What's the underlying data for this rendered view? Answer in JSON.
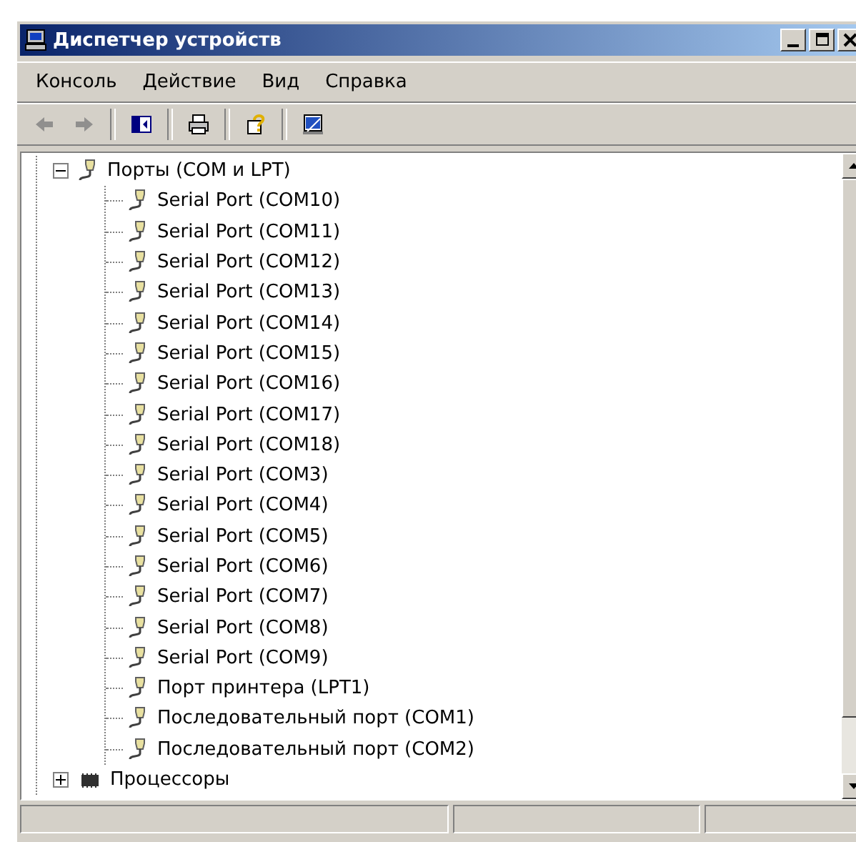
{
  "window": {
    "title": "Диспетчер устройств"
  },
  "menu": [
    "Консоль",
    "Действие",
    "Вид",
    "Справка"
  ],
  "toolbar": [
    {
      "kind": "back",
      "disabled": true
    },
    {
      "kind": "forward",
      "disabled": true
    },
    {
      "kind": "tree-toggle",
      "disabled": false
    },
    {
      "kind": "print",
      "disabled": false
    },
    {
      "kind": "help",
      "disabled": false
    },
    {
      "kind": "update",
      "disabled": false
    }
  ],
  "tree": [
    {
      "label": "Порты (COM и LPT)",
      "kind": "port",
      "expanded": true,
      "children": [
        {
          "label": "Serial Port (COM10)",
          "kind": "port"
        },
        {
          "label": "Serial Port (COM11)",
          "kind": "port"
        },
        {
          "label": "Serial Port (COM12)",
          "kind": "port"
        },
        {
          "label": "Serial Port (COM13)",
          "kind": "port"
        },
        {
          "label": "Serial Port (COM14)",
          "kind": "port"
        },
        {
          "label": "Serial Port (COM15)",
          "kind": "port"
        },
        {
          "label": "Serial Port (COM16)",
          "kind": "port"
        },
        {
          "label": "Serial Port (COM17)",
          "kind": "port"
        },
        {
          "label": "Serial Port (COM18)",
          "kind": "port"
        },
        {
          "label": "Serial Port (COM3)",
          "kind": "port"
        },
        {
          "label": "Serial Port (COM4)",
          "kind": "port"
        },
        {
          "label": "Serial Port (COM5)",
          "kind": "port"
        },
        {
          "label": "Serial Port (COM6)",
          "kind": "port"
        },
        {
          "label": "Serial Port (COM7)",
          "kind": "port"
        },
        {
          "label": "Serial Port (COM8)",
          "kind": "port"
        },
        {
          "label": "Serial Port (COM9)",
          "kind": "port"
        },
        {
          "label": "Порт принтера (LPT1)",
          "kind": "port"
        },
        {
          "label": "Последовательный порт (COM1)",
          "kind": "port"
        },
        {
          "label": "Последовательный порт (COM2)",
          "kind": "port"
        }
      ]
    },
    {
      "label": "Процессоры",
      "kind": "cpu",
      "expanded": false
    }
  ]
}
